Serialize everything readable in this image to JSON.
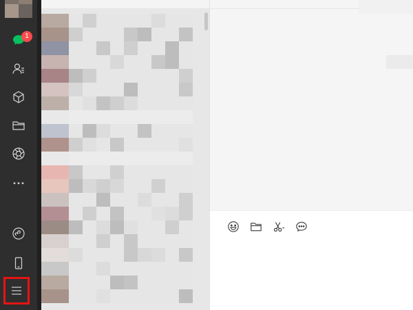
{
  "sidebar": {
    "chat_badge": "1",
    "items": [
      {
        "icon": "chat-icon"
      },
      {
        "icon": "contacts-icon"
      },
      {
        "icon": "box-icon"
      },
      {
        "icon": "folder-icon"
      },
      {
        "icon": "moments-icon"
      },
      {
        "icon": "more-dots-icon"
      },
      {
        "icon": "mini-program-icon"
      },
      {
        "icon": "phone-icon"
      },
      {
        "icon": "menu-icon"
      }
    ],
    "colors": {
      "background": "#2e2e2e",
      "active_icon": "#07c160",
      "inactive_icon": "#d6d6d6",
      "badge": "#f74c4c",
      "menu_highlight": "#e81414"
    }
  },
  "chat_list": {
    "rows": 21
  },
  "conversation": {
    "toolbar": [
      {
        "icon": "emoji-icon"
      },
      {
        "icon": "file-icon"
      },
      {
        "icon": "screenshot-icon"
      },
      {
        "icon": "chat-history-icon"
      }
    ]
  }
}
